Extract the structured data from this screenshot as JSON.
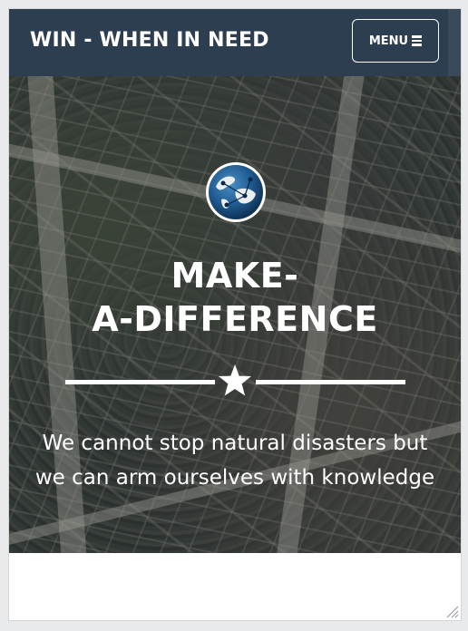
{
  "navbar": {
    "brand": "WIN - WHEN IN NEED",
    "menu_label": "MENU",
    "menu_icon": "bars-icon",
    "background_color": "#2c3e50"
  },
  "hero": {
    "logo_icon": "globe-icon",
    "title_line1": "MAKE-",
    "title_line2": "A-DIFFERENCE",
    "divider_icon": "star-icon",
    "subtitle_line1": "We cannot stop natural disasters but",
    "subtitle_line2": "we can arm ourselves with knowledge"
  }
}
